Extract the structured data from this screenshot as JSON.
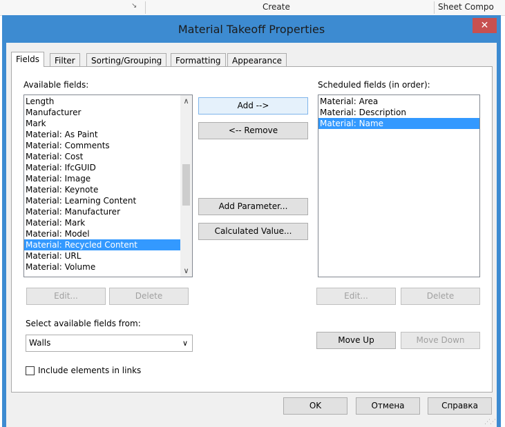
{
  "ribbon": {
    "create_label": "Create",
    "sheet_label": "Sheet Compo",
    "arrow": "↘"
  },
  "dialog": {
    "title": "Material Takeoff Properties",
    "close": "✕"
  },
  "tabs": [
    "Fields",
    "Filter",
    "Sorting/Grouping",
    "Formatting",
    "Appearance"
  ],
  "fields_tab": {
    "available_label": "Available fields:",
    "available_items": [
      "Length",
      "Manufacturer",
      "Mark",
      "Material: As Paint",
      "Material: Comments",
      "Material: Cost",
      "Material: IfcGUID",
      "Material: Image",
      "Material: Keynote",
      "Material: Learning Content",
      "Material: Manufacturer",
      "Material: Mark",
      "Material: Model",
      "Material: Recycled Content",
      "Material: URL",
      "Material: Volume"
    ],
    "available_selected": "Material: Recycled Content",
    "scheduled_label": "Scheduled fields (in order):",
    "scheduled_items": [
      "Material: Area",
      "Material: Description",
      "Material: Name"
    ],
    "scheduled_selected": "Material: Name",
    "add_button": "Add -->",
    "remove_button": "<-- Remove",
    "add_parameter_button": "Add Parameter...",
    "calculated_value_button": "Calculated Value...",
    "edit_left": "Edit...",
    "delete_left": "Delete",
    "edit_right": "Edit...",
    "delete_right": "Delete",
    "select_from_label": "Select available fields from:",
    "select_from_value": "Walls",
    "move_up": "Move Up",
    "move_down": "Move Down",
    "include_links_label": "Include elements in links",
    "include_links_checked": false
  },
  "footer": {
    "ok": "OK",
    "cancel": "Отмена",
    "help": "Справка"
  },
  "colors": {
    "accent": "#3d8bd1",
    "selection": "#3399ff",
    "close": "#c75050"
  }
}
